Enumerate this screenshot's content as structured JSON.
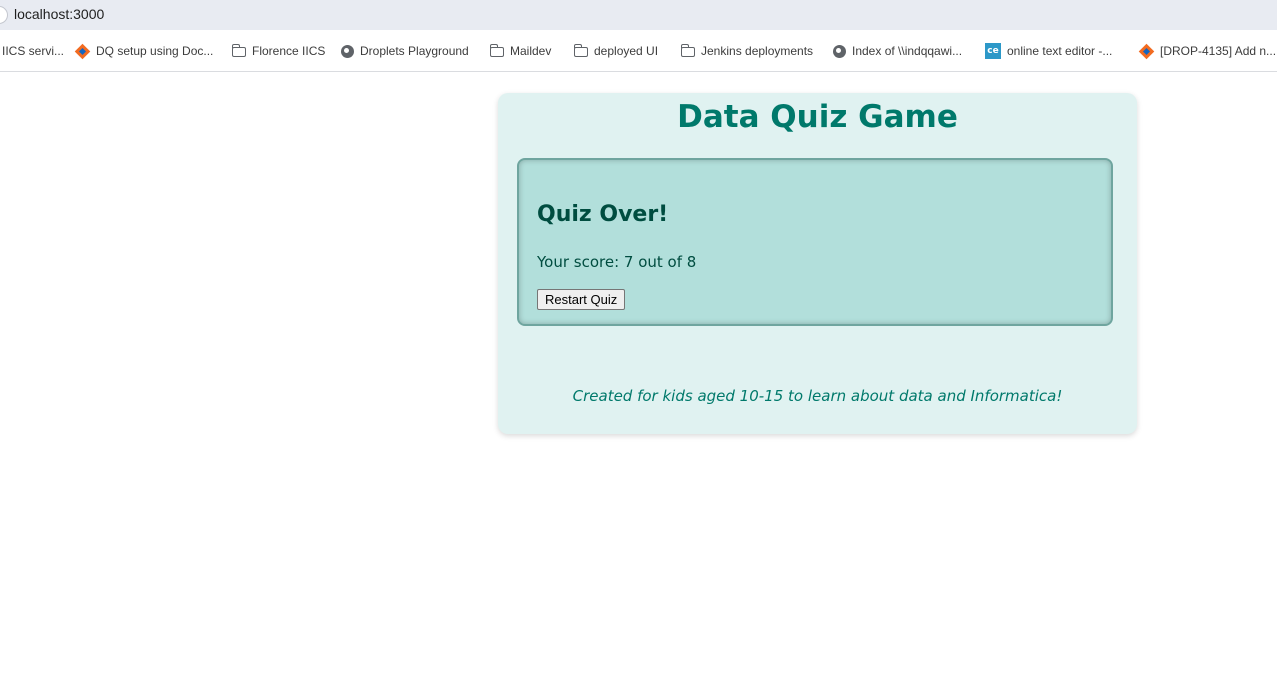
{
  "browser": {
    "url": "localhost:3000",
    "bookmarks": [
      {
        "label": "IICS servi...",
        "icon": "none"
      },
      {
        "label": "DQ setup using Doc...",
        "icon": "informatica-diamond-icon"
      },
      {
        "label": "Florence IICS",
        "icon": "folder-icon"
      },
      {
        "label": "Droplets Playground",
        "icon": "globe-icon"
      },
      {
        "label": "Maildev",
        "icon": "folder-icon"
      },
      {
        "label": "deployed UI",
        "icon": "folder-icon"
      },
      {
        "label": "Jenkins deployments",
        "icon": "folder-icon"
      },
      {
        "label": "Index of \\\\indqqawi...",
        "icon": "globe-icon"
      },
      {
        "label": "online text editor -...",
        "icon": "ce-icon"
      },
      {
        "label": "[DROP-4135] Add n...",
        "icon": "informatica-diamond-icon"
      }
    ]
  },
  "quiz": {
    "title": "Data Quiz Game",
    "result_heading": "Quiz Over!",
    "score_text": "Your score: 7 out of 8",
    "score": 7,
    "total": 8,
    "restart_label": "Restart Quiz",
    "footer": "Created for kids aged 10-15 to learn about data and Informatica!"
  },
  "colors": {
    "card_bg": "#e0f2f1",
    "result_bg": "#b2dfdb",
    "accent": "#00796b",
    "dark_text": "#004d40"
  }
}
